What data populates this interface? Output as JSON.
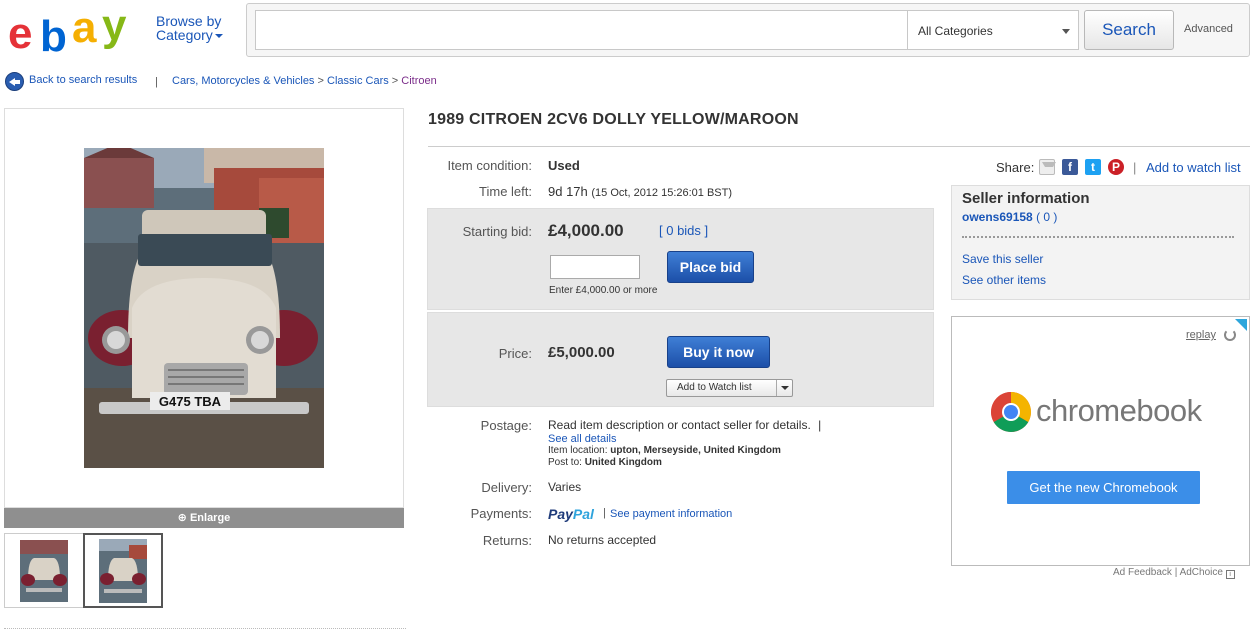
{
  "header": {
    "browse_line1": "Browse by",
    "browse_line2": "Category",
    "search_placeholder": "",
    "category": "All Categories",
    "search_label": "Search",
    "advanced_label": "Advanced"
  },
  "breadcrumb": {
    "back_label": "Back to search results",
    "separator": "|",
    "crumb1": "Cars, Motorcycles & Vehicles",
    "crumb2": "Classic Cars",
    "crumb3": "Citroen",
    "gt": ">"
  },
  "gallery": {
    "enlarge_label": "Enlarge",
    "plate": "G475 TBA"
  },
  "item": {
    "title": "1989 CITROEN 2CV6 DOLLY YELLOW/MAROON",
    "condition_label": "Item condition:",
    "condition": "Used",
    "time_left_label": "Time left:",
    "time_left": "9d 17h",
    "end_time": "(15 Oct, 2012 15:26:01 BST)",
    "starting_bid_label": "Starting bid:",
    "starting_bid": "£4,000.00",
    "bids": "[ 0 bids ]",
    "place_bid_label": "Place bid",
    "bid_hint": "Enter £4,000.00 or more",
    "price_label": "Price:",
    "price": "£5,000.00",
    "buy_now_label": "Buy it now",
    "add_watch_label": "Add to Watch list",
    "postage_label": "Postage:",
    "postage": "Read item description or contact seller for details.",
    "postage_sep": "|",
    "see_all": "See all details",
    "location_label": "Item location:",
    "location": "upton, Merseyside, United Kingdom",
    "post_to_label": "Post to:",
    "post_to": "United Kingdom",
    "delivery_label": "Delivery:",
    "delivery": "Varies",
    "payments_label": "Payments:",
    "paypal_pay": "Pay",
    "paypal_pal": "Pal",
    "payment_sep": "|",
    "payment_info": "See payment information",
    "returns_label": "Returns:",
    "returns": "No returns accepted"
  },
  "share": {
    "label": "Share:",
    "sep": "|",
    "watch_link": "Add to watch list",
    "fb": "f",
    "tw": "t",
    "pin": "P"
  },
  "seller": {
    "title": "Seller information",
    "name": "owens69158",
    "feedback": "( 0 )",
    "save": "Save this seller",
    "other": "See other items"
  },
  "ad": {
    "replay": "replay",
    "brand": "chromebook",
    "cta": "Get the new Chromebook",
    "feedback": "Ad Feedback",
    "sep": "|",
    "adchoice": "AdChoice"
  },
  "colors": {
    "link": "#1a56b8",
    "button_blue": "#1c4fa8",
    "panel_gray": "#e7e7e7"
  }
}
